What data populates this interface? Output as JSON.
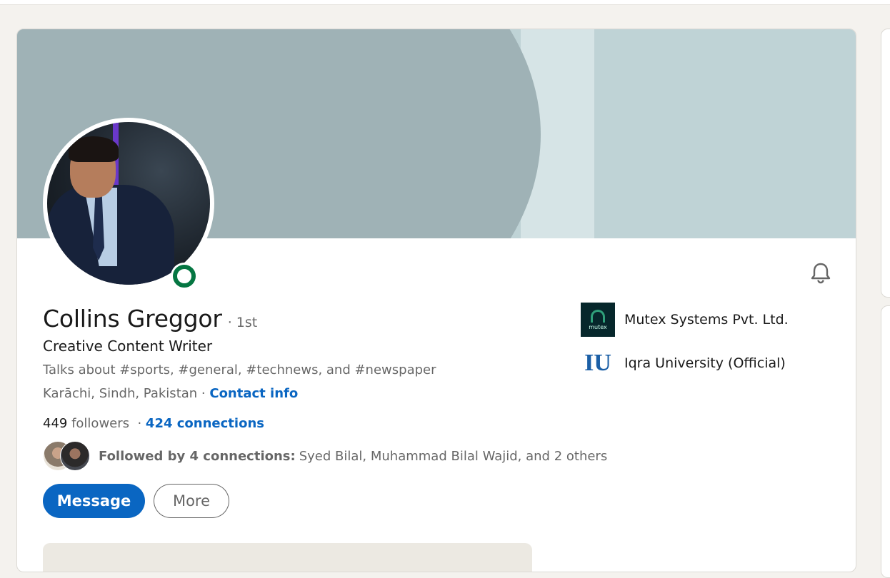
{
  "profile": {
    "name": "Collins Greggor",
    "degree": "· 1st",
    "headline": "Creative Content Writer",
    "talks_about": "Talks about #sports, #general, #technews, and #newspaper",
    "location": "Karāchi, Sindh, Pakistan",
    "location_separator": " · ",
    "contact_info": "Contact info",
    "followers_count": "449",
    "followers_label": " followers",
    "stats_separator": "  · ",
    "connections": "424 connections",
    "followed_by_bold": "Followed by 4 connections:",
    "followed_by_names": "Syed Bilal, Muhammad Bilal Wajid, and 2 others"
  },
  "actions": {
    "message_label": "Message",
    "more_label": "More"
  },
  "companies": [
    {
      "name": "Mutex Systems Pvt. Ltd.",
      "logo_text": "mutex",
      "icon": "mutex-logo"
    },
    {
      "name": "Iqra University (Official)",
      "logo_text": "IU",
      "icon": "iu-logo"
    }
  ],
  "icons": {
    "notification": "bell-icon",
    "status": "online-status-icon"
  },
  "colors": {
    "accent": "#0a66c2",
    "online": "#057642",
    "banner_dark": "#9fb2b6",
    "banner_light": "#bfd3d6",
    "page_bg": "#f4f2ee"
  }
}
